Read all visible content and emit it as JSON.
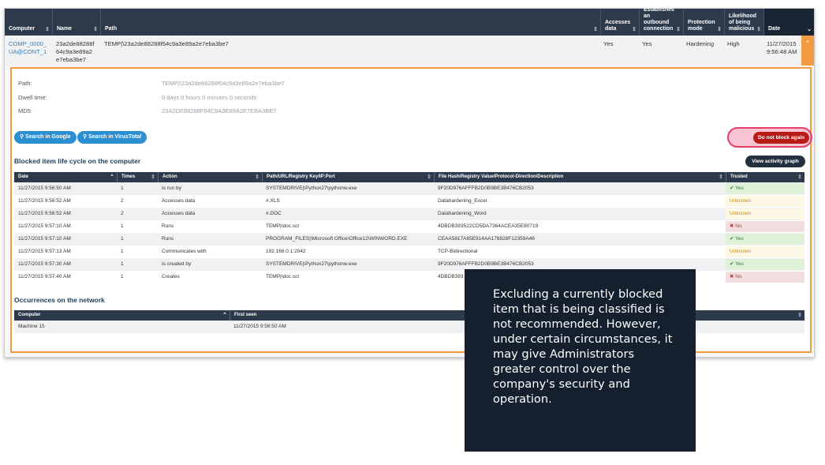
{
  "grid": {
    "headers": [
      "Computer",
      "Name",
      "Path",
      "Accesses data",
      "Establishes an outbound connection",
      "Protection mode",
      "Likelihood of being malicious",
      "Date"
    ],
    "row": {
      "computer": "COMP_0000_\nUA@CONT_1",
      "name": "23a2de88288f\n64c9a3e89a2\ne7eba3be7",
      "path": "TEMP|\\23a2de88288f64c9a3e89a2e7eba3be7",
      "accesses": "Yes",
      "outbound": "Yes",
      "protection": "Hardening",
      "likelihood": "High",
      "date": "11/27/2015\n9:56:48 AM"
    }
  },
  "detail": {
    "path_label": "Path:",
    "path_value": "TEMP|\\23a2de88288f64c9a3e89a2e7eba3be7",
    "dwell_label": "Dwell time:",
    "dwell_value": "0 days 0 hours 0 minutes 0 seconds",
    "md5_label": "MD5:",
    "md5_value": "23A2DE88288F64C9A3E89A2E7EBA3BE7",
    "search_google": "Search in Google",
    "search_virustotal": "Search in VirusTotal",
    "do_not_block": "Do not block again",
    "lifecycle_title": "Blocked item life cycle on the computer",
    "view_activity": "View activity graph",
    "occurrences_title": "Occurrences on the network"
  },
  "lifecycle": {
    "headers": [
      "Date",
      "Times",
      "Action",
      "Path/URL/Registry Key/IP:Port",
      "File Hash/Registry Value/Protocol-Direction/Description",
      "Trusted"
    ],
    "rows": [
      {
        "date": "11/27/2015 9:56:50 AM",
        "times": "1",
        "action": "Is run by",
        "path": "SYSTEMDRIVE|\\Python27\\pythonw.exe",
        "hash": "9F20D976AFFFB2D0B9BE3B476CB2053",
        "trusted": "Yes",
        "status": "yes"
      },
      {
        "date": "11/27/2015 9:56:52 AM",
        "times": "2",
        "action": "Accesses data",
        "path": "#.XLS",
        "hash": "Datahardening_Excel",
        "trusted": "Unknown",
        "status": "unk"
      },
      {
        "date": "11/27/2015 9:56:52 AM",
        "times": "2",
        "action": "Accesses data",
        "path": "#.DOC",
        "hash": "Datahardening_Word",
        "trusted": "Unknown",
        "status": "unk"
      },
      {
        "date": "11/27/2015 9:57:10 AM",
        "times": "1",
        "action": "Runs",
        "path": "TEMP|\\doc.scr",
        "hash": "4DBDB393522CD5DA7364ACEA35E80719",
        "trusted": "No",
        "status": "no"
      },
      {
        "date": "11/27/2015 9:57:10 AM",
        "times": "1",
        "action": "Runs",
        "path": "PROGRAM_FILES|\\Microsoft Office\\Office12\\WINWORD.EXE",
        "hash": "CEAA5817A65E914AA178828F12359A46",
        "trusted": "Yes",
        "status": "yes"
      },
      {
        "date": "11/27/2015 9:57:13 AM",
        "times": "1",
        "action": "Communicates with",
        "path": "192.168.0.1:2042",
        "hash": "TCP-Bidirectional",
        "trusted": "Unknown",
        "status": "unk"
      },
      {
        "date": "11/27/2015 9:57:30 AM",
        "times": "1",
        "action": "Is created by",
        "path": "SYSTEMDRIVE|\\Python27\\pythonw.exe",
        "hash": "9F20D976AFFFB2D0B9BE3B476CB2053",
        "trusted": "Yes",
        "status": "yes"
      },
      {
        "date": "11/27/2015 9:57:40 AM",
        "times": "1",
        "action": "Creates",
        "path": "TEMP|\\doc.scr",
        "hash": "4DBDB393",
        "trusted": "No",
        "status": "no"
      }
    ]
  },
  "occurrences": {
    "headers": [
      "Computer",
      "First seen"
    ],
    "rows": [
      {
        "computer": "Machine 15",
        "first_seen": "11/27/2015 9:56:50 AM"
      }
    ]
  },
  "tooltip": {
    "text": "Excluding a currently blocked item that is being classified is not recommended. However, under certain circumstances, it may give Administrators greater control over the company's security and operation."
  },
  "icons": {
    "sort": "sort-arrows-icon",
    "search": "magnifier-icon",
    "check": "check-icon",
    "cross": "cross-icon",
    "scroll_up": "chevron-up-icon"
  },
  "colors": {
    "header_dark": "#2c3a4b",
    "accent_orange": "#f39b43",
    "button_blue": "#2b8fd1",
    "button_red": "#b81b15",
    "highlight_pink": "#e83d6c",
    "trusted_yes": "#3c763d",
    "trusted_unknown": "#c98a1a",
    "trusted_no": "#a94442",
    "tooltip_bg": "#14202e"
  }
}
